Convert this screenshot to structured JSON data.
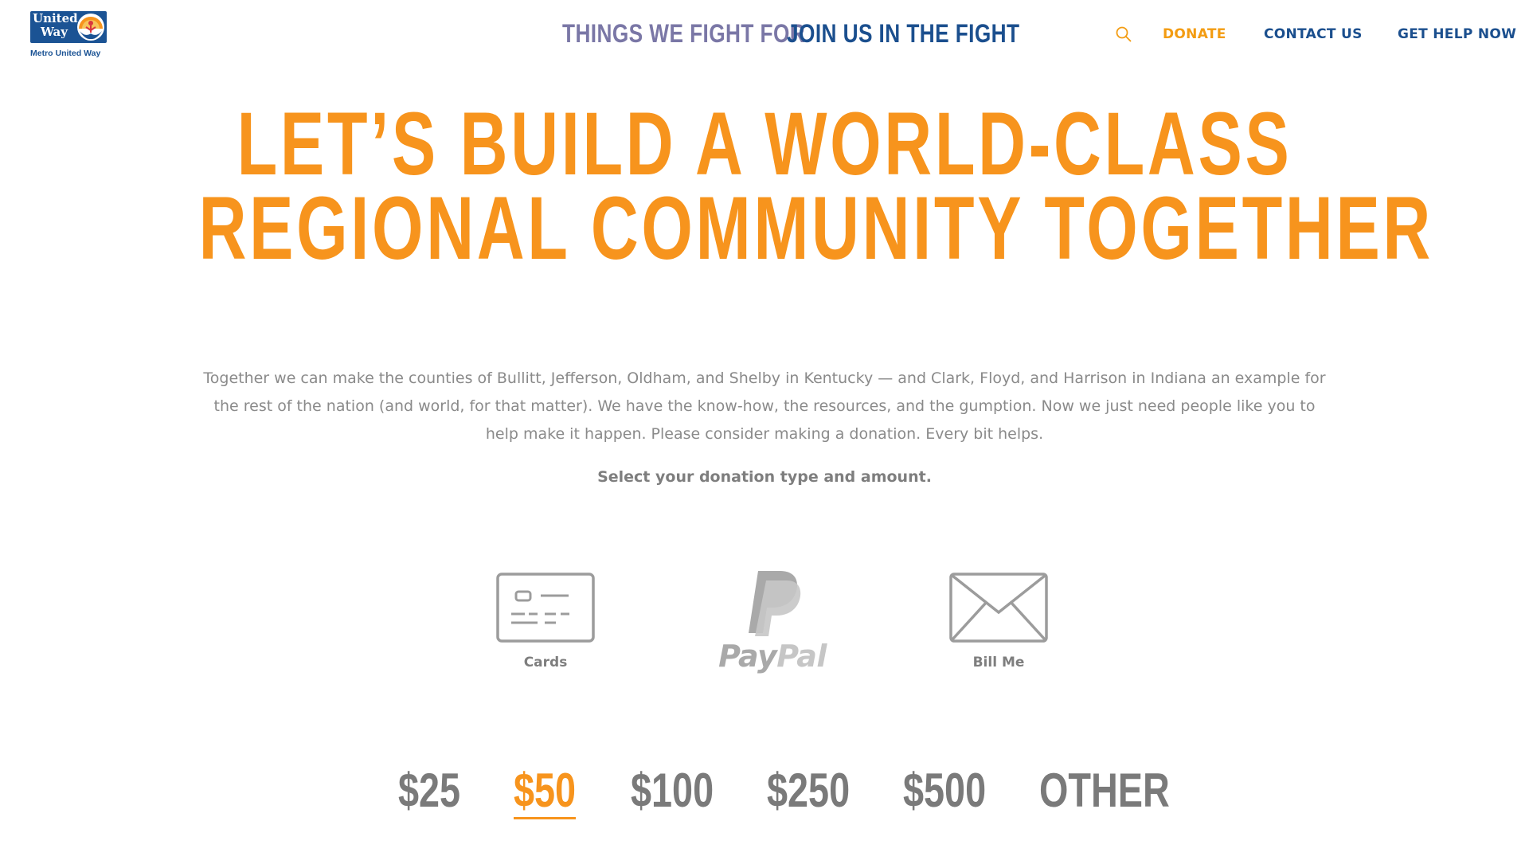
{
  "logo": {
    "line1": "United",
    "line2": "Way",
    "subtitle": "Metro United Way",
    "brand_color": "#1b5394"
  },
  "nav": {
    "primary": [
      {
        "label": "THINGS WE FIGHT FOR",
        "color": "#7a77a6"
      },
      {
        "label": "JOIN US IN THE FIGHT",
        "color": "#1b4f8e"
      }
    ],
    "search_icon": "search-icon",
    "utility": [
      {
        "label": "DONATE",
        "color": "#f39c12"
      },
      {
        "label": "CONTACT US",
        "color": "#1b4f8e"
      },
      {
        "label": "GET HELP NOW",
        "color": "#1b4f8e"
      }
    ]
  },
  "hero": {
    "headline_line1": "LET’S BUILD A WORLD-CLASS",
    "headline_line2": "REGIONAL COMMUNITY TOGETHER",
    "headline_color": "#f7941d",
    "intro": "Together we can make the counties of Bullitt, Jefferson, Oldham, and Shelby in Kentucky — and Clark, Floyd, and Harrison in Indiana an example for the rest of the nation (and world, for that matter). We have the know-how, the resources, and the gumption. Now we just need people like you to help make it happen. Please consider making a donation. Every bit helps.",
    "select_prompt": "Select your donation type and amount."
  },
  "payment_options": [
    {
      "label": "Cards",
      "icon": "credit-card-icon"
    },
    {
      "label_pay": "Pay",
      "label_pal": "Pal",
      "icon": "paypal-icon"
    },
    {
      "label": "Bill Me",
      "icon": "envelope-icon"
    }
  ],
  "amounts": {
    "options": [
      "$25",
      "$50",
      "$100",
      "$250",
      "$500",
      "OTHER"
    ],
    "selected": "$50",
    "selected_color": "#f7941d"
  }
}
